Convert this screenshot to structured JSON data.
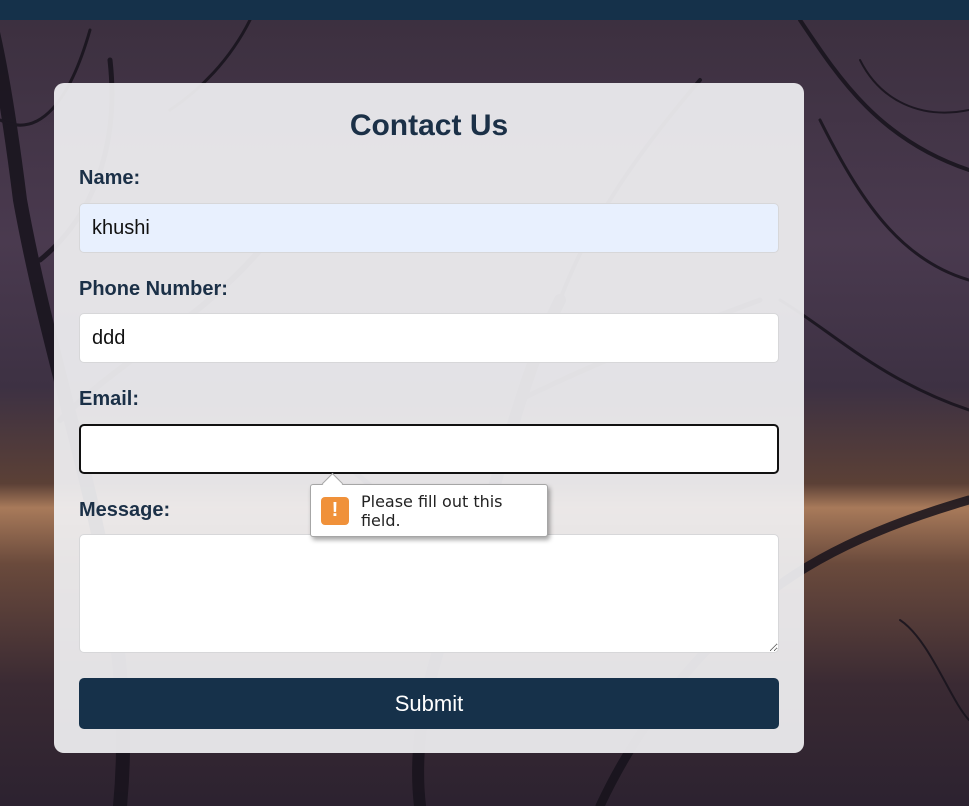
{
  "form": {
    "title": "Contact Us",
    "name": {
      "label": "Name:",
      "value": "khushi"
    },
    "phone": {
      "label": "Phone Number:",
      "value": "ddd"
    },
    "email": {
      "label": "Email:",
      "value": ""
    },
    "message": {
      "label": "Message:",
      "value": ""
    },
    "submit_label": "Submit"
  },
  "validation_tooltip": {
    "icon": "warning-icon",
    "icon_glyph": "!",
    "text": "Please fill out this field."
  },
  "colors": {
    "top_bar": "#15314a",
    "heading": "#1b3047",
    "submit_bg": "#16314a",
    "autofill_bg": "#e8f0fe",
    "warning": "#f0913a"
  }
}
